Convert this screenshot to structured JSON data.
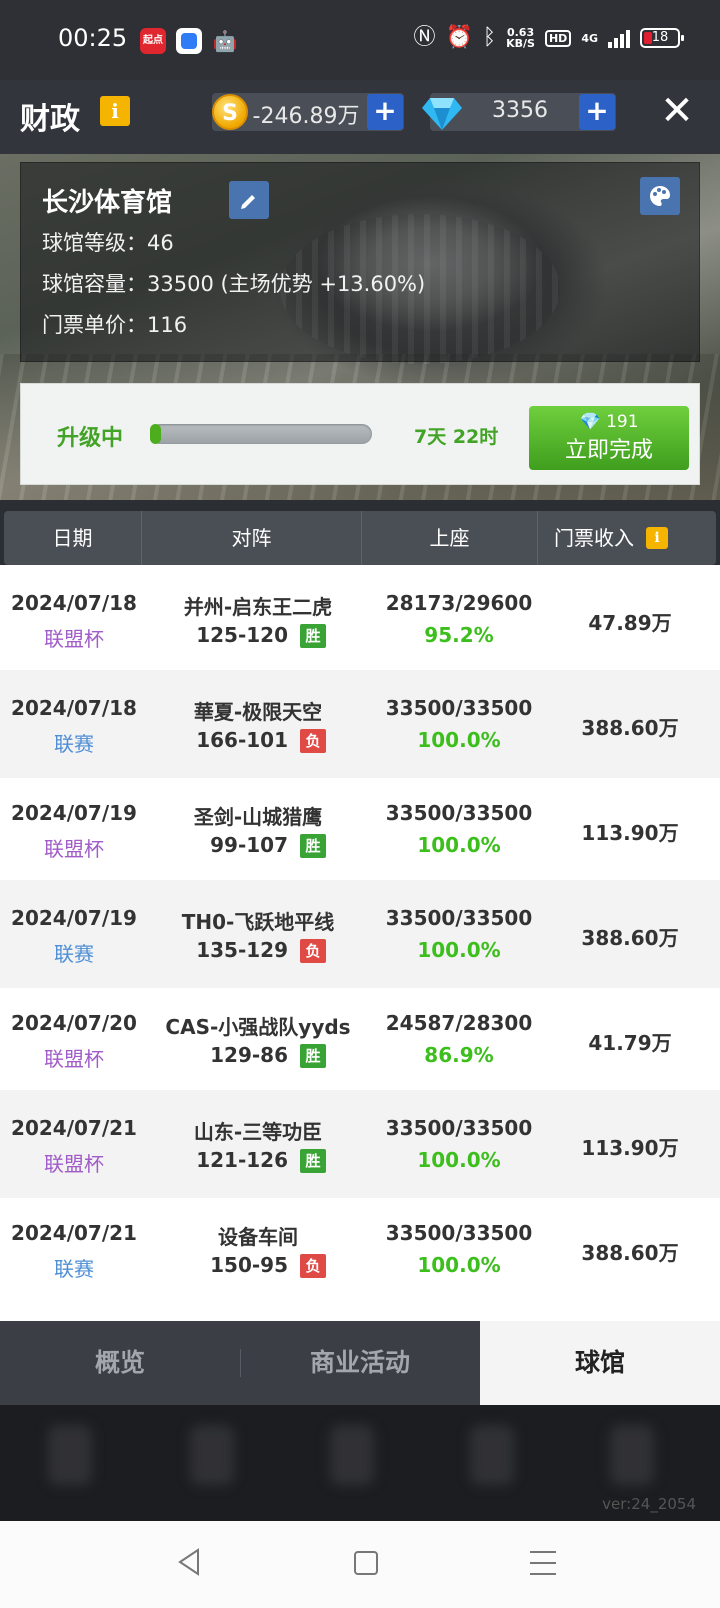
{
  "status_bar": {
    "time": "00:25",
    "qidian_app": "起点",
    "net_speed": "0.63",
    "net_unit": "KB/S",
    "hd": "HD",
    "network": "4G",
    "battery": "18"
  },
  "header": {
    "title": "财政",
    "info": "i",
    "coin_symbol": "S",
    "coins": "-246.89万",
    "gems": "3356",
    "plus": "+",
    "close": "✕"
  },
  "venue": {
    "name": "长沙体育馆",
    "level_line": "球馆等级：46",
    "capacity_line": "球馆容量：33500 (主场优势 +13.60%)",
    "price_line": "门票单价：116"
  },
  "upgrade": {
    "status": "升级中",
    "progress": 0.03,
    "remaining": "7天 22时",
    "cost": "191",
    "finish_label": "立即完成"
  },
  "table": {
    "headers": [
      "日期",
      "对阵",
      "上座",
      "门票收入"
    ],
    "rows": [
      {
        "date": "2024/07/18",
        "competition": "联盟杯",
        "type": "cup",
        "match": "并州-启东王二虎",
        "score": "125-120",
        "result": "胜",
        "outcome": "win",
        "attendance": "28173/29600",
        "rate": "95.2%",
        "revenue": "47.89万"
      },
      {
        "date": "2024/07/18",
        "competition": "联赛",
        "type": "league",
        "match": "華夏-极限天空",
        "score": "166-101",
        "result": "负",
        "outcome": "loss",
        "attendance": "33500/33500",
        "rate": "100.0%",
        "revenue": "388.60万"
      },
      {
        "date": "2024/07/19",
        "competition": "联盟杯",
        "type": "cup",
        "match": "圣剑-山城猎鹰",
        "score": "99-107",
        "result": "胜",
        "outcome": "win",
        "attendance": "33500/33500",
        "rate": "100.0%",
        "revenue": "113.90万"
      },
      {
        "date": "2024/07/19",
        "competition": "联赛",
        "type": "league",
        "match": "TH0-飞跃地平线",
        "score": "135-129",
        "result": "负",
        "outcome": "loss",
        "attendance": "33500/33500",
        "rate": "100.0%",
        "revenue": "388.60万"
      },
      {
        "date": "2024/07/20",
        "competition": "联盟杯",
        "type": "cup",
        "match": "CAS-小强战队yyds",
        "score": "129-86",
        "result": "胜",
        "outcome": "win",
        "attendance": "24587/28300",
        "rate": "86.9%",
        "revenue": "41.79万"
      },
      {
        "date": "2024/07/21",
        "competition": "联盟杯",
        "type": "cup",
        "match": "山东-三等功臣",
        "score": "121-126",
        "result": "胜",
        "outcome": "win",
        "attendance": "33500/33500",
        "rate": "100.0%",
        "revenue": "113.90万"
      },
      {
        "date": "2024/07/21",
        "competition": "联赛",
        "type": "league",
        "match": "设备车间",
        "score": "150-95",
        "result": "负",
        "outcome": "loss",
        "attendance": "33500/33500",
        "rate": "100.0%",
        "revenue": "388.60万"
      }
    ]
  },
  "tabs": [
    "概览",
    "商业活动",
    "球馆"
  ],
  "active_tab": 2,
  "version": "ver:24_2054",
  "colors": {
    "cup": "#a15cc9",
    "league": "#4f8fd6",
    "win": "#3aa335",
    "loss": "#e04a44",
    "rate": "#3cbf1c",
    "accent_blue": "#2c62c7",
    "info_yellow": "#f5b400"
  },
  "icons": [
    "coin-icon",
    "diamond-icon",
    "plus-icon",
    "close-icon",
    "edit-icon",
    "palette-icon",
    "info-icon",
    "back-icon",
    "home-icon",
    "menu-icon"
  ]
}
